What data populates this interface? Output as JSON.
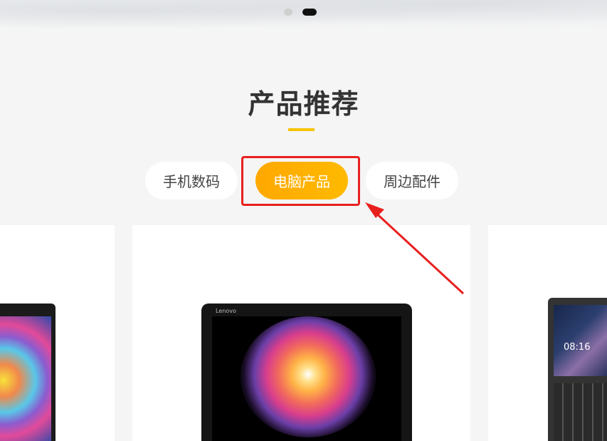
{
  "section": {
    "title": "产品推荐"
  },
  "tabs": [
    {
      "label": "手机数码"
    },
    {
      "label": "电脑产品"
    },
    {
      "label": "周边配件"
    }
  ],
  "carousel": {
    "active_index": 2,
    "total": 2
  },
  "products": [
    {
      "brand": ""
    },
    {
      "brand": "Lenovo"
    },
    {
      "clock": "08:16"
    }
  ],
  "colors": {
    "accent": "#f5c300",
    "active_tab": "#ffa800",
    "annotation": "#e8201f",
    "title": "#333333"
  },
  "icons": [
    "carousel-dot",
    "red-arrow-annotation",
    "highlight-box"
  ]
}
